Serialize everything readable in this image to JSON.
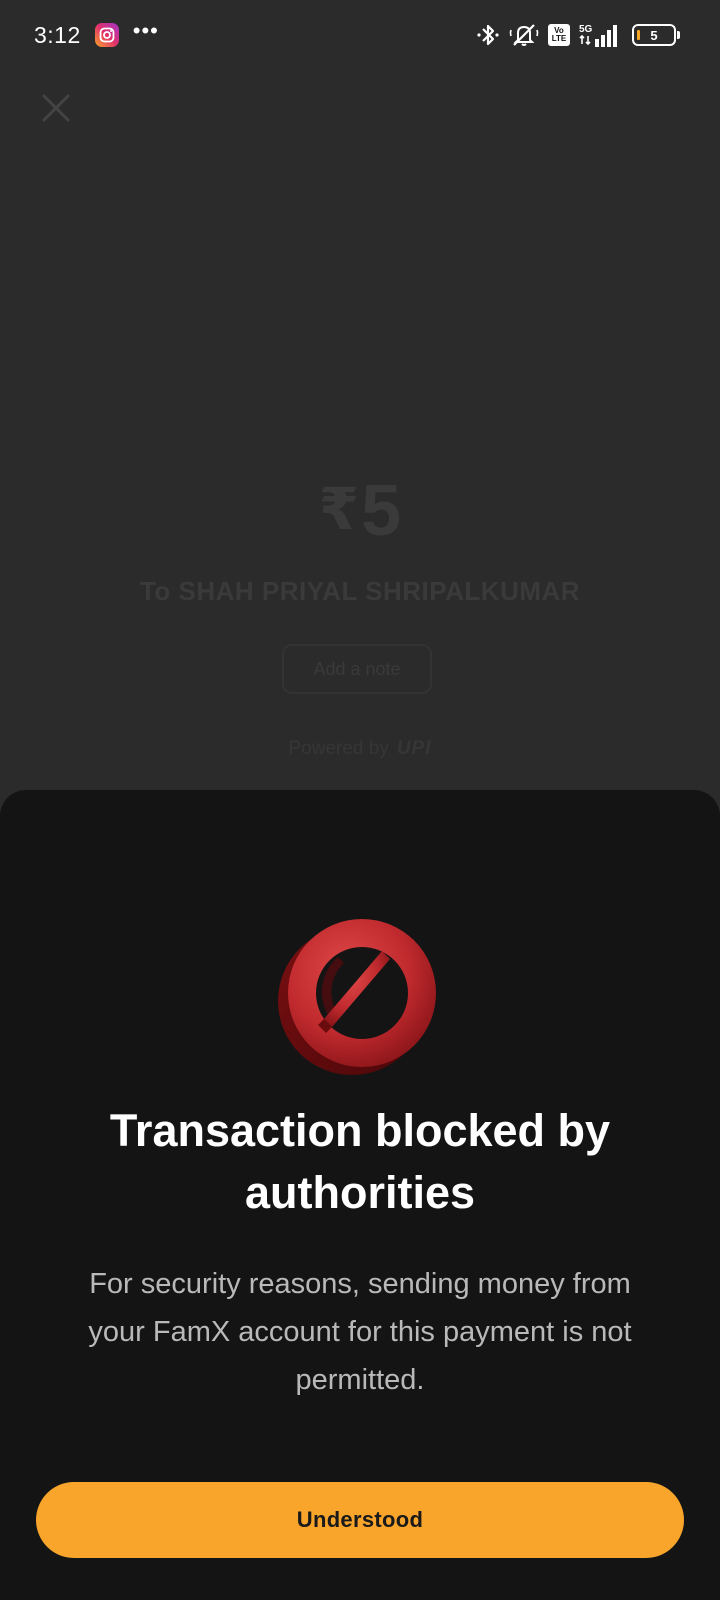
{
  "status_bar": {
    "time": "3:12",
    "battery_level": "5",
    "network": "5G",
    "volte_top": "Vo",
    "volte_bottom": "LTE",
    "icons": [
      "instagram-icon",
      "more-dots-icon",
      "bluetooth-icon",
      "mute-icon",
      "volte-icon",
      "signal-icon",
      "battery-icon"
    ]
  },
  "payment": {
    "currency_symbol": "₹",
    "amount": "5",
    "recipient": "To SHAH PRIYAL SHRIPALKUMAR",
    "add_note_label": "Add a note",
    "powered_by": "Powered by",
    "upi_label": "UPI"
  },
  "sheet": {
    "icon": "blocked-icon",
    "title": "Transaction blocked by authorities",
    "message": "For security reasons, sending money from your FamX account for this payment is not permitted.",
    "button_label": "Understood"
  },
  "colors": {
    "accent": "#f9a52b",
    "sheet_bg": "#141414",
    "screen_bg": "#2b2b2b",
    "blocked_red": "#c8302f"
  }
}
